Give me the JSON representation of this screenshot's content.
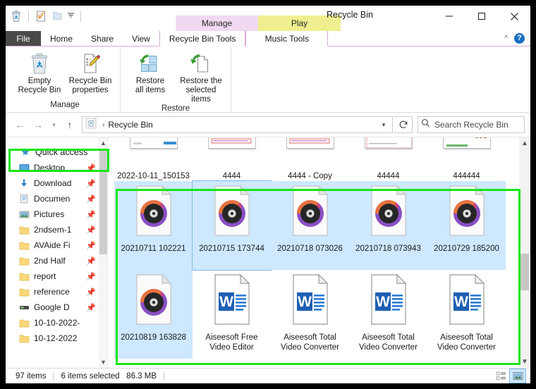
{
  "window": {
    "title": "Recycle Bin",
    "controls": {
      "minimize": "minimize-icon",
      "maximize": "maximize-icon",
      "close": "close-icon"
    }
  },
  "quick_access_toolbar": {
    "items": [
      {
        "name": "recycle-bin-icon",
        "label": "Recycle Bin"
      },
      {
        "name": "properties-icon",
        "label": "Recycle Bin properties"
      },
      {
        "name": "folder-icon",
        "label": "New folder"
      },
      {
        "name": "customize-dropdown-icon",
        "label": "Customize Quick Access Toolbar"
      }
    ]
  },
  "contextual_tab_groups": [
    {
      "title": "Manage",
      "color": "#f2d9f2",
      "sub_tab": "Recycle Bin Tools"
    },
    {
      "title": "Play",
      "color": "#f0ef90",
      "sub_tab": "Music Tools"
    }
  ],
  "ribbon": {
    "tabs": [
      {
        "label": "File",
        "active": false,
        "kind": "file"
      },
      {
        "label": "Home",
        "active": false,
        "kind": "normal"
      },
      {
        "label": "Share",
        "active": false,
        "kind": "normal"
      },
      {
        "label": "View",
        "active": false,
        "kind": "normal"
      },
      {
        "label": "Recycle Bin Tools",
        "active": true,
        "kind": "contextual"
      },
      {
        "label": "Music Tools",
        "active": false,
        "kind": "contextual"
      }
    ],
    "collapse_label": "Collapse the Ribbon",
    "help_label": "?",
    "groups": [
      {
        "label": "Manage",
        "buttons": [
          {
            "label_line1": "Empty",
            "label_line2": "Recycle Bin",
            "icon": "empty-recycle-bin-icon"
          },
          {
            "label_line1": "Recycle Bin",
            "label_line2": "properties",
            "icon": "recycle-bin-properties-icon"
          }
        ]
      },
      {
        "label": "Restore",
        "buttons": [
          {
            "label_line1": "Restore",
            "label_line2": "all items",
            "icon": "restore-all-items-icon"
          },
          {
            "label_line1": "Restore the",
            "label_line2": "selected items",
            "icon": "restore-selected-items-icon"
          }
        ]
      }
    ]
  },
  "navigation": {
    "back_label": "Back",
    "forward_label": "Forward",
    "recent_label": "Recent locations",
    "up_label": "Up",
    "breadcrumb": {
      "icon": "recycle-bin-icon",
      "separator": "›",
      "path": "Recycle Bin"
    },
    "address_dropdown": "⌄",
    "refresh_label": "Refresh",
    "search": {
      "placeholder": "Search Recycle Bin",
      "value": "",
      "icon": "search-icon"
    }
  },
  "sidebar": {
    "items": [
      {
        "label": "Quick access",
        "icon": "star-pin-icon",
        "header": true,
        "pinned": false,
        "selected": true
      },
      {
        "label": "Desktop",
        "icon": "desktop-icon",
        "header": false,
        "pinned": true
      },
      {
        "label": "Download",
        "icon": "downloads-icon",
        "header": false,
        "pinned": true
      },
      {
        "label": "Documen",
        "icon": "documents-icon",
        "header": false,
        "pinned": true
      },
      {
        "label": "Pictures",
        "icon": "pictures-icon",
        "header": false,
        "pinned": true
      },
      {
        "label": "2ndsem-1",
        "icon": "folder-icon",
        "header": false,
        "pinned": true
      },
      {
        "label": "AVAide Fi",
        "icon": "folder-icon",
        "header": false,
        "pinned": true
      },
      {
        "label": "2nd Half",
        "icon": "folder-icon",
        "header": false,
        "pinned": true
      },
      {
        "label": "report",
        "icon": "folder-icon",
        "header": false,
        "pinned": true
      },
      {
        "label": "reference",
        "icon": "folder-icon",
        "header": false,
        "pinned": true
      },
      {
        "label": "Google D",
        "icon": "drive-icon",
        "header": false,
        "pinned": true
      },
      {
        "label": "10-10-2022-",
        "icon": "folder-icon",
        "header": false,
        "pinned": false
      },
      {
        "label": "10-12-2022",
        "icon": "folder-icon",
        "header": false,
        "pinned": false
      }
    ]
  },
  "files": {
    "row_partial": [
      {
        "label": "2022-10-11_150153",
        "icon": "screenshot-thumbnail",
        "selected": false
      },
      {
        "label": "4444",
        "icon": "screenshot-thumbnail",
        "selected": false
      },
      {
        "label": "4444 - Copy",
        "icon": "screenshot-thumbnail",
        "selected": false
      },
      {
        "label": "44444",
        "icon": "screenshot-thumbnail",
        "selected": false
      },
      {
        "label": "444444",
        "icon": "screenshot-thumbnail",
        "selected": false
      }
    ],
    "rows": [
      [
        {
          "label": "20210711 102221",
          "icon": "media-file-icon",
          "selected": true,
          "focused": false
        },
        {
          "label": "20210715 173744",
          "icon": "media-file-icon",
          "selected": true,
          "focused": true
        },
        {
          "label": "20210718 073026",
          "icon": "media-file-icon",
          "selected": true,
          "focused": false
        },
        {
          "label": "20210718 073943",
          "icon": "media-file-icon",
          "selected": true,
          "focused": false
        },
        {
          "label": "20210729 185200",
          "icon": "media-file-icon",
          "selected": true,
          "focused": false
        }
      ],
      [
        {
          "label": "20210819 163828",
          "icon": "media-file-icon",
          "selected": true,
          "focused": false
        },
        {
          "label": "Aiseesoft Free Video Editor",
          "icon": "word-document-icon",
          "selected": false,
          "focused": false
        },
        {
          "label": "Aiseesoft Total Video Converter",
          "icon": "word-document-icon",
          "selected": false,
          "focused": false
        },
        {
          "label": "Aiseesoft Total Video Converter",
          "icon": "word-document-icon",
          "selected": false,
          "focused": false
        },
        {
          "label": "Aiseesoft Total Video Converter",
          "icon": "word-document-icon",
          "selected": false,
          "focused": false
        }
      ]
    ]
  },
  "statusbar": {
    "item_count": "97 items",
    "selection": "6 items selected",
    "size": "86.3 MB",
    "views": [
      {
        "name": "details-view-button",
        "label": "Details view",
        "active": false
      },
      {
        "name": "large-icons-view-button",
        "label": "Large icons view",
        "active": true
      }
    ]
  },
  "annotations": {
    "highlight_color": "#16e616",
    "boxes": [
      {
        "name": "quick-access-highlight",
        "target": "Quick access"
      },
      {
        "name": "selected-files-highlight",
        "target": "selected files region"
      }
    ]
  }
}
